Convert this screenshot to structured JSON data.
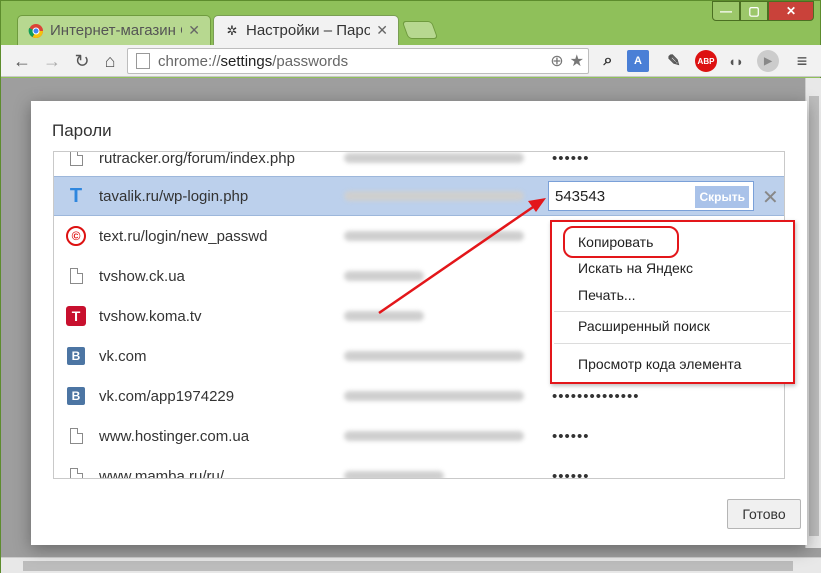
{
  "window": {
    "tabs": [
      {
        "title": "Интернет-магазин С",
        "active": false,
        "icon": "chrome-icon"
      },
      {
        "title": "Настройки – Пароли",
        "active": true,
        "icon": "settings-gear-icon"
      }
    ],
    "controls": {
      "minimize": "—",
      "maximize": "▢",
      "close": "✕"
    }
  },
  "toolbar": {
    "url_prefix": "chrome://",
    "url_host": "settings",
    "url_path": "/passwords",
    "extensions": [
      "search-icon",
      "translate-icon",
      "pin-icon",
      "adblock-plus-icon",
      "audio-icon",
      "media-icon",
      "menu-icon"
    ],
    "abp_label": "ABP"
  },
  "dialog": {
    "title": "Пароли",
    "done_label": "Готово",
    "rows": [
      {
        "site": "rutracker.org/forum/index.php",
        "password": "••••••",
        "icon": "document"
      },
      {
        "site": "tavalik.ru/wp-login.php",
        "password": "543543",
        "icon": "tavalik",
        "selected": true,
        "hide_label": "Скрыть"
      },
      {
        "site": "text.ru/login/new_passwd",
        "password": "",
        "icon": "textru"
      },
      {
        "site": "tvshow.ck.ua",
        "password": "",
        "icon": "document"
      },
      {
        "site": "tvshow.koma.tv",
        "password": "",
        "icon": "koma"
      },
      {
        "site": "vk.com",
        "password": "",
        "icon": "vk"
      },
      {
        "site": "vk.com/app1974229",
        "password": "••••••••••••••",
        "icon": "vk"
      },
      {
        "site": "www.hostinger.com.ua",
        "password": "••••••",
        "icon": "document"
      },
      {
        "site": "www.mamba.ru/ru/",
        "password": "••••••",
        "icon": "document"
      }
    ]
  },
  "context_menu": {
    "items": [
      "Копировать",
      "Искать на Яндекс",
      "Печать...",
      "Расширенный поиск",
      "Просмотр кода элемента"
    ]
  },
  "colors": {
    "highlight": "#e3161a",
    "selection": "#bcd0ec",
    "frame": "#8fc05a"
  }
}
